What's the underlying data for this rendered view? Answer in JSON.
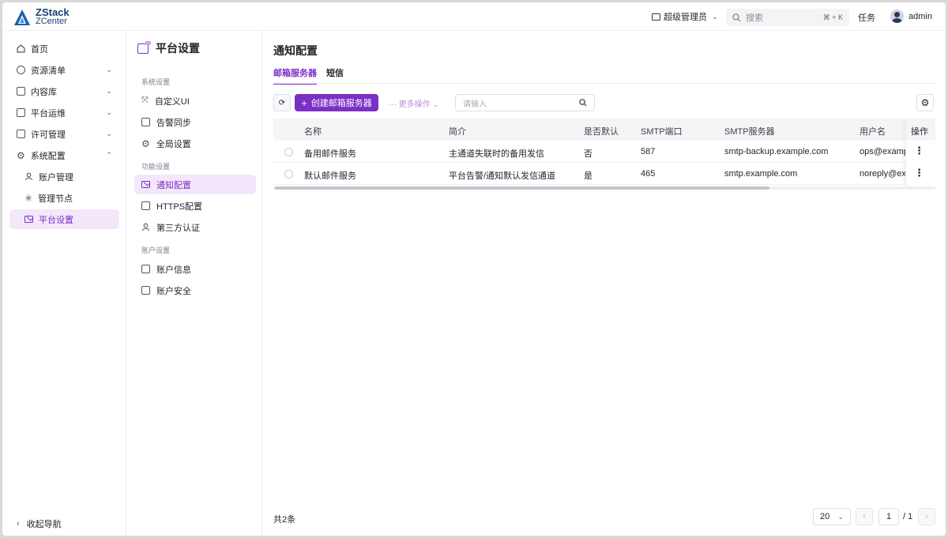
{
  "app": {
    "brand_line1": "ZStack",
    "brand_line2": "ZCenter"
  },
  "header": {
    "role": "超级管理员",
    "search_placeholder": "搜索",
    "search_shortcut": "⌘ + K",
    "tasks": "任务",
    "user": "admin"
  },
  "nav": {
    "items": [
      {
        "label": "首页"
      },
      {
        "label": "资源清单"
      },
      {
        "label": "内容库"
      },
      {
        "label": "平台运维"
      },
      {
        "label": "许可管理"
      },
      {
        "label": "系统配置"
      },
      {
        "label": "账户管理"
      },
      {
        "label": "管理节点"
      },
      {
        "label": "平台设置"
      }
    ],
    "collapse": "收起导航"
  },
  "panel": {
    "title": "平台设置",
    "group_system": "系统设置",
    "group_function": "功能设置",
    "group_account": "账户设置",
    "items": [
      {
        "label": "自定义UI"
      },
      {
        "label": "告警同步"
      },
      {
        "label": "全局设置"
      },
      {
        "label": "通知配置"
      },
      {
        "label": "HTTPS配置"
      },
      {
        "label": "第三方认证"
      },
      {
        "label": "账户信息"
      },
      {
        "label": "账户安全"
      }
    ]
  },
  "main": {
    "title": "通知配置",
    "tabs": [
      {
        "label": "邮箱服务器"
      },
      {
        "label": "短信"
      }
    ],
    "create_button": "创建邮箱服务器",
    "more_actions": "更多操作",
    "filter_placeholder": "请输入",
    "columns": [
      "名称",
      "简介",
      "是否默认",
      "SMTP端口",
      "SMTP服务器",
      "用户名",
      "操作"
    ],
    "rows": [
      {
        "name": "备用邮件服务",
        "desc": "主通道失联时的备用发信",
        "default": "否",
        "port": "587",
        "server": "smtp-backup.example.com",
        "user": "ops@example.com"
      },
      {
        "name": "默认邮件服务",
        "desc": "平台告警/通知默认发信通道",
        "default": "是",
        "port": "465",
        "server": "smtp.example.com",
        "user": "noreply@example.com"
      }
    ],
    "total": "共2条",
    "page_size": "20",
    "current_page": "1",
    "total_pages": "/ 1"
  },
  "colors": {
    "accent": "#7b2fc4",
    "accent_bg": "#f3e8fb",
    "brand": "#1d3f72"
  }
}
